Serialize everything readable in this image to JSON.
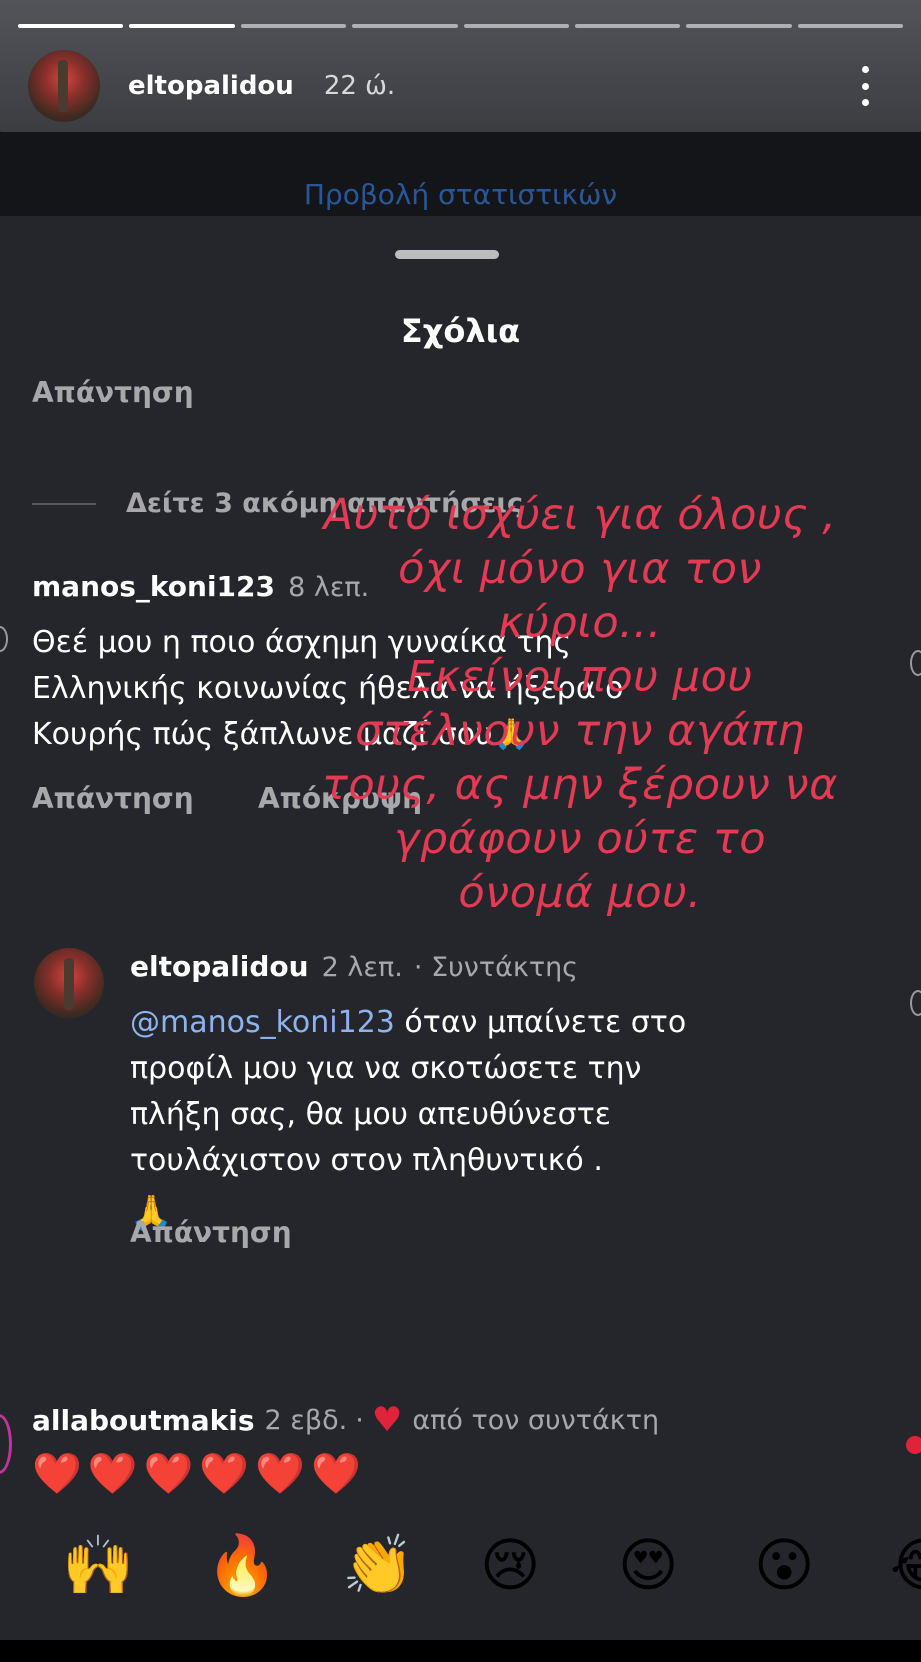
{
  "story": {
    "username": "eltopalidou",
    "time": "22 ώ.",
    "stats_link": "Προβολή στατιστικών"
  },
  "sheet": {
    "title": "Σχόλια",
    "top_reply_label": "Απάντηση",
    "more_replies": "Δείτε 3 ακόμη απαντήσεις"
  },
  "comments": [
    {
      "username": "manos_koni123",
      "time": "8 λεπ.",
      "text_lines": [
        "Θεέ μου η ποιο άσχημη γυναίκα της",
        "Ελληνικής κοινωνίας ήθελα να ήξερα ο",
        "Κουρής πώς ξάπλωνε μαζί σου🙏"
      ],
      "reply_label": "Απάντηση",
      "hide_label": "Απόκρυψη"
    },
    {
      "username": "eltopalidou",
      "time": "2 λεπ.",
      "role": "· Συντάκτης",
      "mention": "@manos_koni123",
      "text_lines": [
        " όταν μπαίνετε στο",
        "προφίλ μου για να σκοτώσετε την",
        "πλήξη σας, θα μου απευθύνεστε",
        "τουλάχιστον στον πληθυντικό ."
      ],
      "emoji_line": "🙏",
      "reply_label": "Απάντηση"
    },
    {
      "username": "allaboutmakis",
      "time": "2 εβδ.",
      "liked_by": "από τον συντάκτη",
      "heart": "♥",
      "hearts": "❤️❤️❤️❤️❤️❤️"
    }
  ],
  "overlay_lines": [
    "Αυτό ισχύει για όλους ,",
    "όχι μόνο για τον",
    "κύριο...",
    "Εκείνοι που μου",
    "στέλνουν την αγάπη",
    "τους, ας μην ξέρουν να",
    "γράφουν ούτε το",
    "όνομά μου."
  ],
  "reactions": [
    "🙌",
    "🔥",
    "👏",
    "😢",
    "😍",
    "😮",
    "😂"
  ],
  "colors": {
    "overlay_text": "#e43a53",
    "mention": "#8db3ee",
    "sheet_bg": "#25262b"
  }
}
